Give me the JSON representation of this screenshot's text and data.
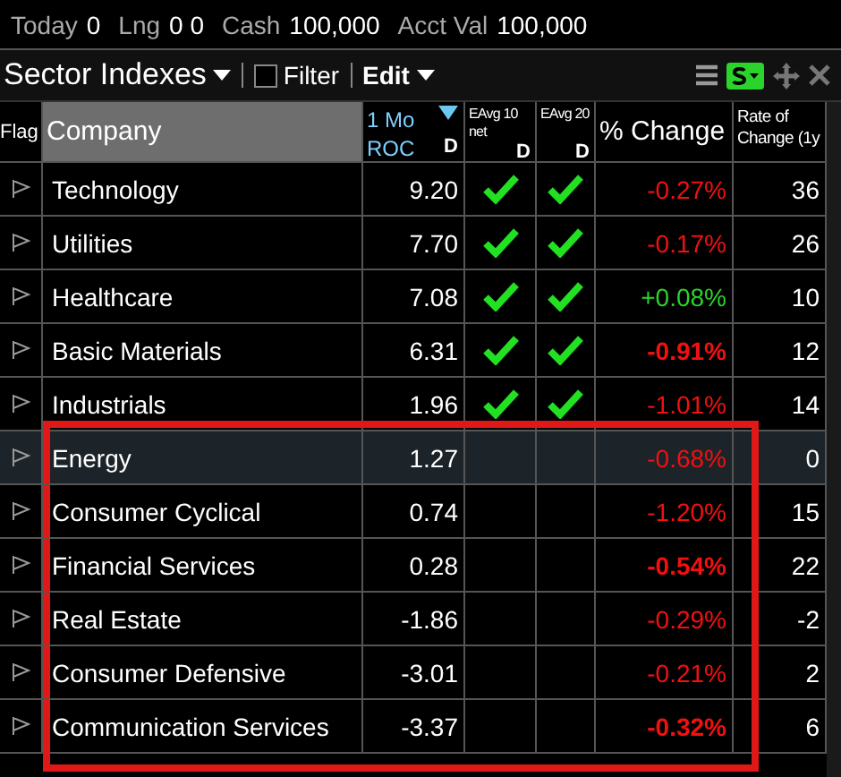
{
  "account_bar": [
    {
      "label": "Today",
      "value": "0"
    },
    {
      "label": "Lng",
      "value": "0 0"
    },
    {
      "label": "Cash",
      "value": "100,000"
    },
    {
      "label": "Acct Val",
      "value": "100,000"
    }
  ],
  "toolbar": {
    "title": "Sector Indexes",
    "filter": {
      "label": "Filter",
      "checked": false
    },
    "edit": "Edit"
  },
  "table": {
    "columns": [
      {
        "kind": "flag",
        "label": "Flag",
        "sorted": false
      },
      {
        "kind": "name",
        "label": "Company",
        "sorted": false
      },
      {
        "kind": "num",
        "label": "1 Mo ROC",
        "sub": "D",
        "sorted": true
      },
      {
        "kind": "check",
        "label": "EAvg 10 net",
        "sub": "D",
        "sorted": false
      },
      {
        "kind": "check",
        "label": "EAvg 20",
        "sub": "D",
        "sorted": false
      },
      {
        "kind": "pct",
        "label": "% Change",
        "sorted": false
      },
      {
        "kind": "num",
        "label": "Rate of Change (1y",
        "sorted": false
      }
    ],
    "rows": [
      {
        "company": "Technology",
        "roc": "9.20",
        "eavg10": true,
        "eavg20": true,
        "change": "-0.27%",
        "color": "#f31010",
        "bold": false,
        "rate": "36",
        "selected": false,
        "highlighted": false
      },
      {
        "company": "Utilities",
        "roc": "7.70",
        "eavg10": true,
        "eavg20": true,
        "change": "-0.17%",
        "color": "#f31010",
        "bold": false,
        "rate": "26",
        "selected": false,
        "highlighted": false
      },
      {
        "company": "Healthcare",
        "roc": "7.08",
        "eavg10": true,
        "eavg20": true,
        "change": "+0.08%",
        "color": "#2bd42b",
        "bold": false,
        "rate": "10",
        "selected": false,
        "highlighted": false
      },
      {
        "company": "Basic Materials",
        "roc": "6.31",
        "eavg10": true,
        "eavg20": true,
        "change": "-0.91%",
        "color": "#f31010",
        "bold": true,
        "rate": "12",
        "selected": false,
        "highlighted": false
      },
      {
        "company": "Industrials",
        "roc": "1.96",
        "eavg10": true,
        "eavg20": true,
        "change": "-1.01%",
        "color": "#f31010",
        "bold": false,
        "rate": "14",
        "selected": false,
        "highlighted": false
      },
      {
        "company": "Energy",
        "roc": "1.27",
        "eavg10": false,
        "eavg20": false,
        "change": "-0.68%",
        "color": "#f31010",
        "bold": false,
        "rate": "0",
        "selected": true,
        "highlighted": true
      },
      {
        "company": "Consumer Cyclical",
        "roc": "0.74",
        "eavg10": false,
        "eavg20": false,
        "change": "-1.20%",
        "color": "#f31010",
        "bold": false,
        "rate": "15",
        "selected": false,
        "highlighted": true
      },
      {
        "company": "Financial Services",
        "roc": "0.28",
        "eavg10": false,
        "eavg20": false,
        "change": "-0.54%",
        "color": "#f31010",
        "bold": true,
        "rate": "22",
        "selected": false,
        "highlighted": true
      },
      {
        "company": "Real Estate",
        "roc": "-1.86",
        "eavg10": false,
        "eavg20": false,
        "change": "-0.29%",
        "color": "#f31010",
        "bold": false,
        "rate": "-2",
        "selected": false,
        "highlighted": true
      },
      {
        "company": "Consumer Defensive",
        "roc": "-3.01",
        "eavg10": false,
        "eavg20": false,
        "change": "-0.21%",
        "color": "#f31010",
        "bold": false,
        "rate": "2",
        "selected": false,
        "highlighted": true
      },
      {
        "company": "Communication Services",
        "roc": "-3.37",
        "eavg10": false,
        "eavg20": false,
        "change": "-0.32%",
        "color": "#f31010",
        "bold": true,
        "rate": "6",
        "selected": false,
        "highlighted": true
      }
    ]
  }
}
